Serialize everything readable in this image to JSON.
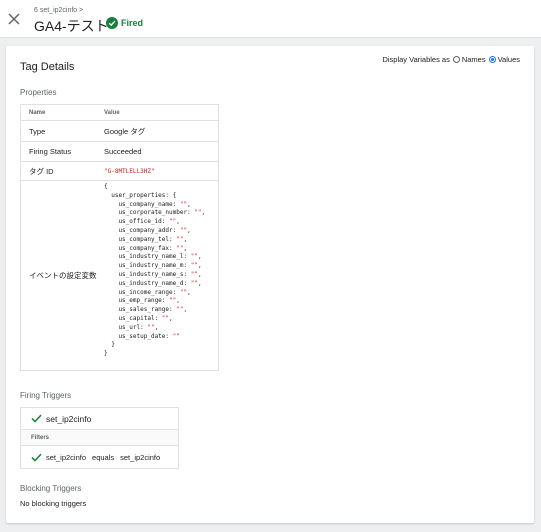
{
  "header": {
    "breadcrumb": "6 set_ip2cinfo >",
    "title": "GA4-テスト",
    "status": "Fired",
    "status_color": "#188038",
    "close_icon": "close-icon"
  },
  "display_variables": {
    "label": "Display Variables as",
    "options": [
      "Names",
      "Values"
    ],
    "selected": "Values"
  },
  "tag_details": {
    "title": "Tag Details",
    "properties_label": "Properties",
    "columns": [
      "Name",
      "Value"
    ],
    "rows": [
      {
        "name": "Type",
        "value": "Google タグ"
      },
      {
        "name": "Firing Status",
        "value": "Succeeded"
      },
      {
        "name": "タグ ID",
        "value": "\"G-8MTLELL3HZ\""
      },
      {
        "name": "イベントの設定変数",
        "value": "{\n  user_properties: {\n    us_company_name: \"\",\n    us_corporate_number: \"\",\n    us_office_id: \"\",\n    us_company_addr: \"\",\n    us_company_tel: \"\",\n    us_company_fax: \"\",\n    us_industry_name_l: \"\",\n    us_industry_name_m: \"\",\n    us_industry_name_s: \"\",\n    us_industry_name_d: \"\",\n    us_income_range: \"\",\n    us_emp_range: \"\",\n    us_sales_range: \"\",\n    us_capital: \"\",\n    us_url: \"\",\n    us_setup_date: \"\"\n  }\n}"
      }
    ]
  },
  "firing_triggers": {
    "label": "Firing Triggers",
    "trigger_name": "set_ip2cinfo",
    "filters_label": "Filters",
    "filter": {
      "left": "set_ip2cinfo",
      "op": "equals",
      "right": "set_ip2cinfo"
    }
  },
  "blocking_triggers": {
    "label": "Blocking Triggers",
    "empty_text": "No blocking triggers"
  }
}
